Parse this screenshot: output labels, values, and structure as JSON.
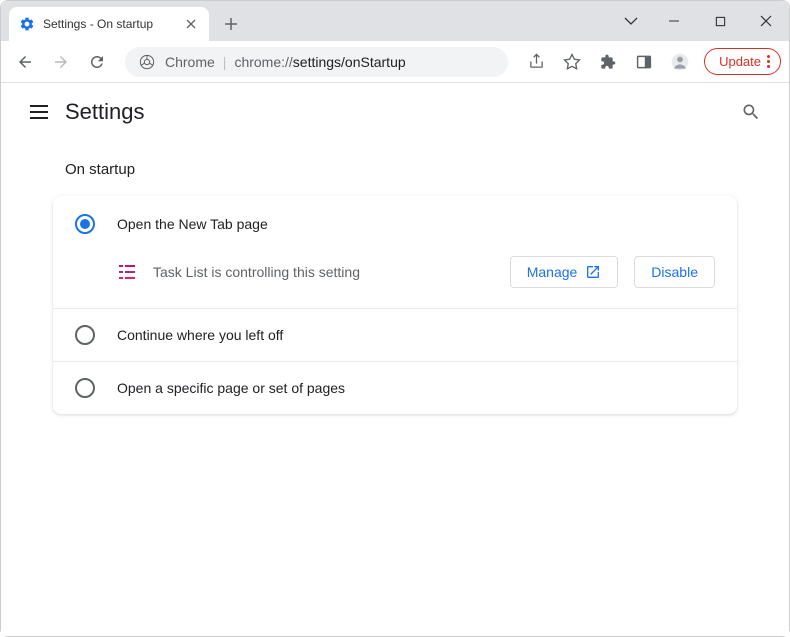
{
  "window": {
    "tab_title": "Settings - On startup"
  },
  "toolbar": {
    "address_prefix": "Chrome",
    "address_scheme": "chrome://",
    "address_path": "settings/onStartup",
    "update_label": "Update"
  },
  "header": {
    "title": "Settings"
  },
  "section": {
    "title": "On startup"
  },
  "options": {
    "open_new_tab": "Open the New Tab page",
    "continue": "Continue where you left off",
    "specific_pages": "Open a specific page or set of pages"
  },
  "extension": {
    "name": "Task List",
    "message": "Task List is controlling this setting",
    "manage_label": "Manage",
    "disable_label": "Disable"
  }
}
